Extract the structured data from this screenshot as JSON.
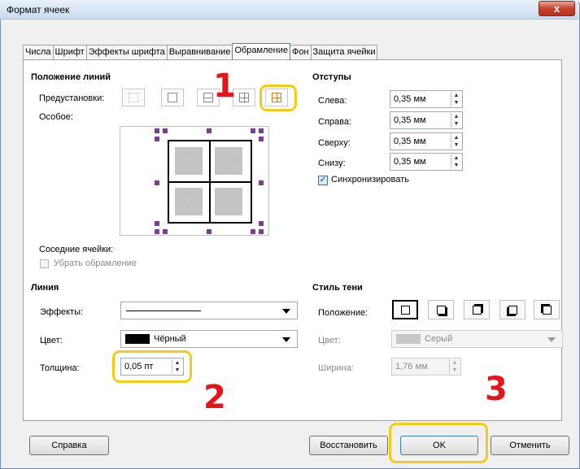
{
  "window": {
    "title": "Формат ячеек",
    "close_symbol": "x"
  },
  "tabs": [
    {
      "label": "Числа"
    },
    {
      "label": "Шрифт"
    },
    {
      "label": "Эффекты шрифта"
    },
    {
      "label": "Выравнивание"
    },
    {
      "label": "Обрамление",
      "active": true
    },
    {
      "label": "Фон"
    },
    {
      "label": "Защита ячейки"
    }
  ],
  "line_position": {
    "heading": "Положение линий",
    "presets_label": "Предустановки:",
    "presets": [
      "no-borders-icon",
      "outer-border-icon",
      "outer-and-horizontal-icon",
      "outer-and-inner-icon",
      "outer-and-all-icon"
    ],
    "custom_label": "Особое:",
    "adjacent_label": "Соседние ячейки:",
    "remove_borders_label": "Убрать обрамление"
  },
  "padding": {
    "heading": "Отступы",
    "left_label": "Слева:",
    "left_value": "0,35 мм",
    "right_label": "Справа:",
    "right_value": "0,35 мм",
    "top_label": "Сверху:",
    "top_value": "0,35 мм",
    "bottom_label": "Снизу:",
    "bottom_value": "0,35 мм",
    "sync_label": "Синхронизировать",
    "sync_checked": true
  },
  "line": {
    "heading": "Линия",
    "effects_label": "Эффекты:",
    "color_label": "Цвет:",
    "color_value": "Чёрный",
    "width_label": "Толщина:",
    "width_value": "0,05 пт"
  },
  "shadow": {
    "heading": "Стиль тени",
    "position_label": "Положение:",
    "color_label": "Цвет:",
    "color_value": "Серый",
    "width_label": "Ширина:",
    "width_value": "1,76 мм"
  },
  "buttons": {
    "help": "Справка",
    "reset": "Восстановить",
    "ok": "OK",
    "cancel": "Отменить"
  },
  "annotations": {
    "step1": "1",
    "step2": "2",
    "step3": "3"
  },
  "colors": {
    "highlight": "#f5cc15",
    "annotation_red": "#e8141c",
    "handle_purple": "#7a3f8f"
  }
}
